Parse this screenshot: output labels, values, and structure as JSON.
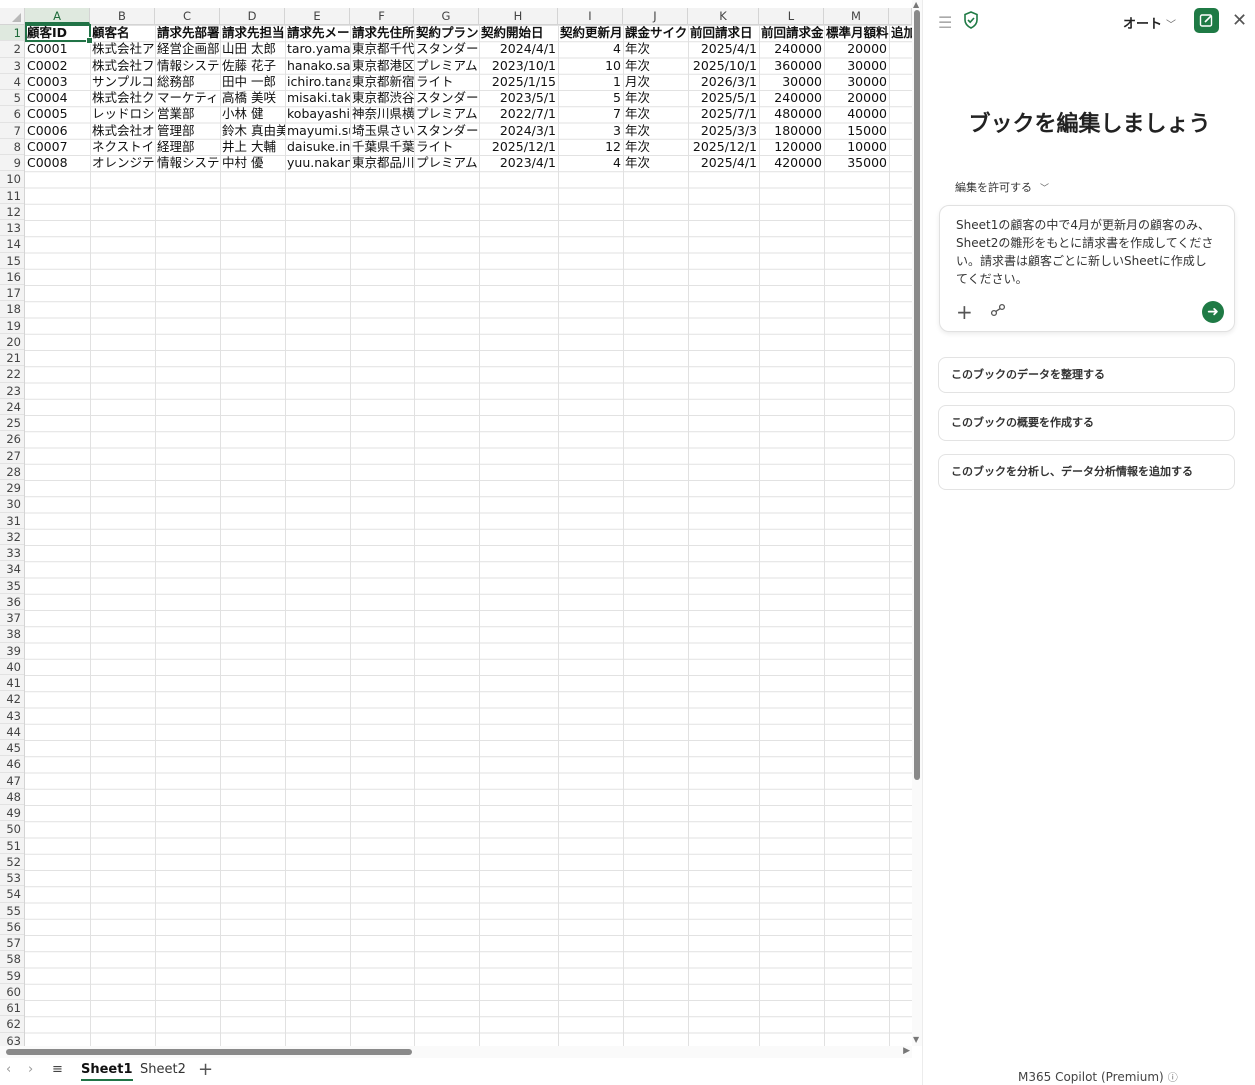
{
  "sheet": {
    "columns": [
      "A",
      "B",
      "C",
      "D",
      "E",
      "F",
      "G",
      "H",
      "I",
      "J",
      "K",
      "L",
      "M"
    ],
    "extra_column_header_fragment": "追加",
    "headers": [
      "顧客ID",
      "顧客名",
      "請求先部署",
      "請求先担当",
      "請求先メー",
      "請求先住所",
      "契約プラン",
      "契約開始日",
      "契約更新月",
      "課金サイク",
      "前回請求日",
      "前回請求金",
      "標準月額料"
    ],
    "rows": [
      [
        "C0001",
        "株式会社ア",
        "経営企画部",
        "山田 太郎",
        "taro.yamac",
        "東京都千代",
        "スタンダー",
        "2024/4/1",
        "4",
        "年次",
        "2025/4/1",
        "240000",
        "20000"
      ],
      [
        "C0002",
        "株式会社フ",
        "情報システ",
        "佐藤 花子",
        "hanako.sa",
        "東京都港区",
        "プレミアム",
        "2023/10/1",
        "10",
        "年次",
        "2025/10/1",
        "360000",
        "30000"
      ],
      [
        "C0003",
        "サンプルコ",
        "総務部",
        "田中 一郎",
        "ichiro.tana",
        "東京都新宿",
        "ライト",
        "2025/1/15",
        "1",
        "月次",
        "2026/3/1",
        "30000",
        "30000"
      ],
      [
        "C0004",
        "株式会社ク",
        "マーケティ",
        "高橋 美咲",
        "misaki.tak",
        "東京都渋谷",
        "スタンダー",
        "2023/5/1",
        "5",
        "年次",
        "2025/5/1",
        "240000",
        "20000"
      ],
      [
        "C0005",
        "レッドロシ",
        "営業部",
        "小林 健",
        "kobayashi",
        "神奈川県横",
        "プレミアム",
        "2022/7/1",
        "7",
        "年次",
        "2025/7/1",
        "480000",
        "40000"
      ],
      [
        "C0006",
        "株式会社オ",
        "管理部",
        "鈴木 真由美",
        "mayumi.su",
        "埼玉県さい",
        "スタンダー",
        "2024/3/1",
        "3",
        "年次",
        "2025/3/3",
        "180000",
        "15000"
      ],
      [
        "C0007",
        "ネクストイ",
        "経理部",
        "井上 大輔",
        "daisuke.in",
        "千葉県千葉",
        "ライト",
        "2025/12/1",
        "12",
        "年次",
        "2025/12/1",
        "120000",
        "10000"
      ],
      [
        "C0008",
        "オレンジテ",
        "情報システ",
        "中村 優",
        "yuu.nakam",
        "東京都品川",
        "プレミアム",
        "2023/4/1",
        "4",
        "年次",
        "2025/4/1",
        "420000",
        "35000"
      ]
    ],
    "row_count": 63
  },
  "tabs": {
    "sheet1": "Sheet1",
    "sheet2": "Sheet2",
    "add": "+"
  },
  "copilot": {
    "mode_label": "オート",
    "title": "ブックを編集しましょう",
    "permission_label": "編集を許可する",
    "prompt_text": "Sheet1の顧客の中で4月が更新月の顧客のみ、Sheet2の雛形をもとに請求書を作成してください。請求書は顧客ごとに新しいSheetに作成してください。",
    "suggestions": [
      "このブックのデータを整理する",
      "このブックの概要を作成する",
      "このブックを分析し、データ分析情報を追加する"
    ],
    "footer": "M365 Copilot (Premium)",
    "colors": {
      "accent": "#1f7a45",
      "excel_green": "#217346"
    },
    "icons": [
      "hamburger-icon",
      "shield-check-icon",
      "new-chat-icon",
      "close-icon",
      "plus-icon",
      "attach-icon",
      "send-icon",
      "info-icon"
    ]
  }
}
